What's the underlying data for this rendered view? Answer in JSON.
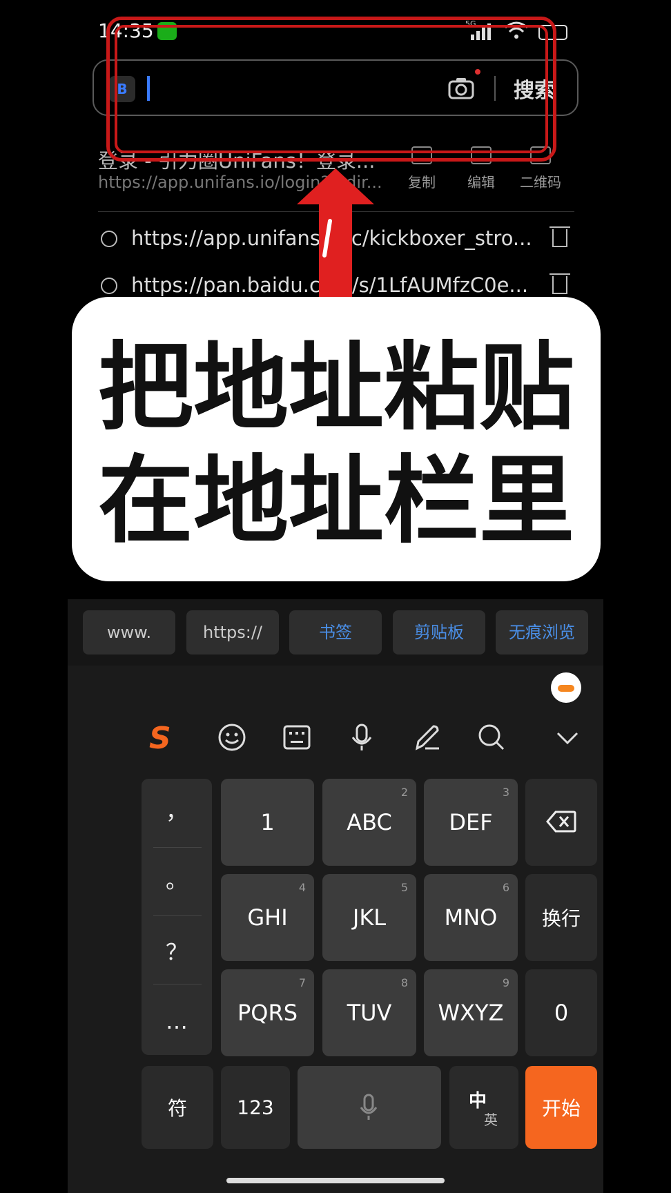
{
  "status_bar": {
    "time": "14:35",
    "network_label": "5G",
    "more": "···"
  },
  "search_bar": {
    "engine_glyph": "B",
    "query": "",
    "search_button_label": "搜索"
  },
  "clipboard_suggestion": {
    "title": "登录 - 引力圈UniFans！登录...",
    "url": "https://app.unifans.io/login?redir...",
    "actions": [
      {
        "label": "复制",
        "icon": "copy-icon"
      },
      {
        "label": "编辑",
        "icon": "edit-icon"
      },
      {
        "label": "二维码",
        "icon": "qr-code-icon"
      }
    ]
  },
  "history": [
    {
      "url": "https://app.unifans.io/c/kickboxer_stro..."
    },
    {
      "url": "https://pan.baidu.com/s/1LfAUMfzC0e..."
    }
  ],
  "shortcuts": [
    "www.",
    "https://",
    "书签",
    "剪贴板",
    "无痕浏览"
  ],
  "keyboard": {
    "brand": "S",
    "toolbar_icons": [
      "emoji-icon",
      "keyboard-icon",
      "microphone-icon",
      "handwriting-icon",
      "search-icon",
      "chevron-down-icon"
    ],
    "punctuation": [
      "，",
      "。",
      "？",
      "…"
    ],
    "keys": [
      {
        "main": "1",
        "sub": ""
      },
      {
        "main": "ABC",
        "sub": "2"
      },
      {
        "main": "DEF",
        "sub": "3"
      },
      {
        "main": "GHI",
        "sub": "4"
      },
      {
        "main": "JKL",
        "sub": "5"
      },
      {
        "main": "MNO",
        "sub": "6"
      },
      {
        "main": "PQRS",
        "sub": "7"
      },
      {
        "main": "TUV",
        "sub": "8"
      },
      {
        "main": "WXYZ",
        "sub": "9"
      }
    ],
    "newline_label": "换行",
    "zero_label": "0",
    "symbol_label": "符",
    "numeric_label": "123",
    "lang_main": "中",
    "lang_sub": "英",
    "go_label": "开始"
  },
  "annotation": {
    "line1": "把地址粘贴",
    "line2": "在地址栏里",
    "colors": {
      "box": "#c81818",
      "arrow": "#e02020"
    }
  }
}
